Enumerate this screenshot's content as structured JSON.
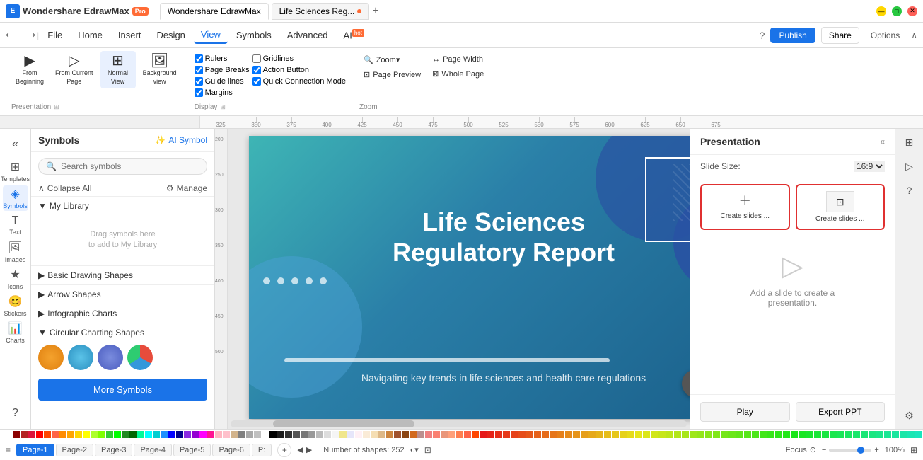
{
  "app": {
    "name": "Wondershare EdrawMax",
    "pro_badge": "Pro",
    "tab1_label": "Wondershare EdrawMax",
    "tab2_label": "Life Sciences Reg...",
    "tab2_dot": true
  },
  "window_controls": {
    "minimize": "—",
    "maximize": "□",
    "close": "✕"
  },
  "menu": {
    "items": [
      "File",
      "Home",
      "Insert",
      "Design",
      "View",
      "Symbols",
      "Advanced",
      "AI"
    ],
    "active": "View",
    "ai_hot": "hot",
    "publish": "Publish",
    "share": "Share",
    "options": "Options"
  },
  "ribbon": {
    "presentation_group": {
      "label": "Presentation",
      "from_beginning": "From\nBeginning",
      "from_current": "From Current\nPage",
      "normal_view": "Normal\nView",
      "background_view": "Background\nview"
    },
    "display_group": {
      "label": "Display",
      "rulers": "Rulers",
      "page_breaks": "Page Breaks",
      "guide_lines": "Guide lines",
      "margins": "Margins",
      "gridlines": "Gridlines",
      "action_button": "Action Button",
      "quick_connection": "Quick Connection Mode"
    },
    "zoom_group": {
      "label": "Zoom",
      "zoom": "Zoom▾",
      "page_preview": "Page Preview",
      "page_width": "Page Width",
      "whole_page": "Whole Page"
    }
  },
  "symbols_panel": {
    "title": "Symbols",
    "ai_symbol": "AI Symbol",
    "search_placeholder": "Search symbols",
    "collapse_all": "Collapse All",
    "manage": "Manage",
    "my_library": "My Library",
    "drag_hint": "Drag symbols here\nto add to My Library",
    "sections": [
      {
        "name": "Basic Drawing Shapes",
        "expanded": false
      },
      {
        "name": "Arrow Shapes",
        "expanded": false
      },
      {
        "name": "Infographic Charts",
        "expanded": false
      },
      {
        "name": "Circular Charting Shapes",
        "expanded": true
      }
    ],
    "more_symbols": "More Symbols"
  },
  "canvas": {
    "slide_title": "Life Sciences\nRegulatory Report",
    "slide_subtitle": "Navigating key trends in life sciences and health care regulations"
  },
  "right_panel": {
    "title": "Presentation",
    "collapse_arrow": "«",
    "slide_size_label": "Slide Size:",
    "slide_size_value": "16:9",
    "create_btn1": "Create slides ...",
    "create_btn2": "Create slides ...",
    "add_hint_line1": "Add a slide to create a",
    "add_hint_line2": "presentation.",
    "play": "Play",
    "export": "Export PPT"
  },
  "status_bar": {
    "page_label": "Page-1",
    "pages": [
      "Page-1",
      "Page-2",
      "Page-3",
      "Page-4",
      "Page-5",
      "Page-6",
      "P:"
    ],
    "active_page": "Page-1",
    "shape_count": "Number of shapes: 252",
    "focus": "Focus",
    "zoom_percent": "100%"
  },
  "colors": [
    "#8B0000",
    "#B22222",
    "#DC143C",
    "#FF0000",
    "#FF4500",
    "#FF6347",
    "#FF8C00",
    "#FFA500",
    "#FFD700",
    "#FFFF00",
    "#ADFF2F",
    "#7FFF00",
    "#32CD32",
    "#00FF00",
    "#228B22",
    "#006400",
    "#00FA9A",
    "#00FFFF",
    "#00CED1",
    "#1E90FF",
    "#0000FF",
    "#00008B",
    "#8A2BE2",
    "#9400D3",
    "#FF00FF",
    "#FF1493",
    "#FFB6C1",
    "#FFC0CB",
    "#D2B48C",
    "#808080",
    "#A9A9A9",
    "#C0C0C0",
    "#FFFFFF",
    "#000000",
    "#1C1C1C",
    "#333333",
    "#555555",
    "#777777",
    "#999999",
    "#BBBBBB",
    "#DDDDDD",
    "#F5F5F5",
    "#F0E68C",
    "#E6E6FA",
    "#FFF0F5",
    "#FAEBD7",
    "#F5DEB3",
    "#DEB887",
    "#CD853F",
    "#A0522D",
    "#8B4513",
    "#D2691E",
    "#BC8F8F",
    "#F08080",
    "#FA8072",
    "#E9967A",
    "#FFA07A",
    "#FF7F50",
    "#FF6347",
    "#FF4500"
  ]
}
